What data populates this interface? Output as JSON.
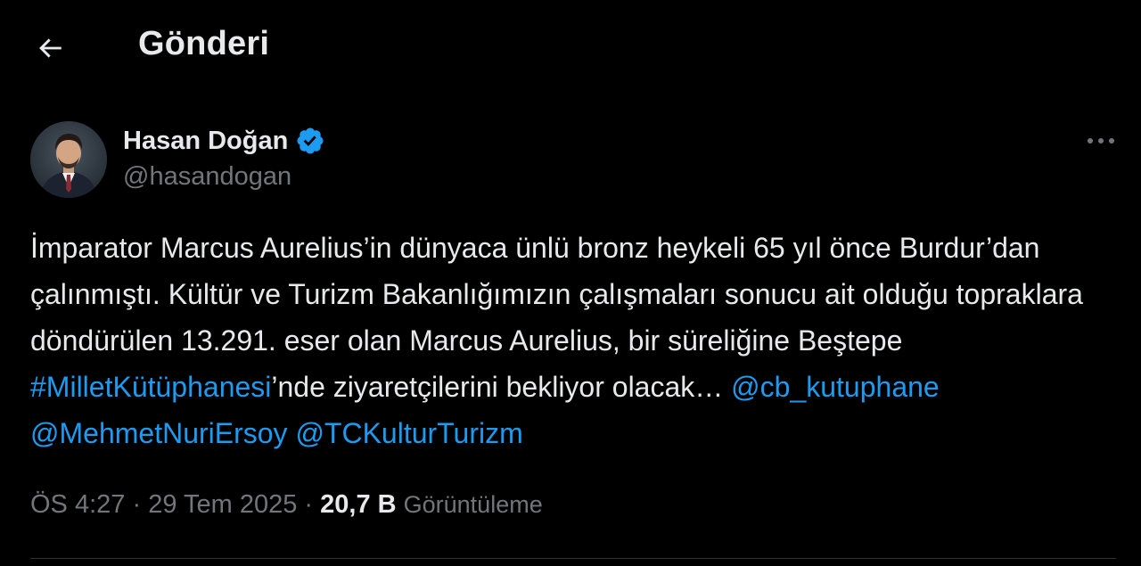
{
  "header": {
    "title": "Gönderi",
    "back_icon": "arrow-left-icon"
  },
  "author": {
    "name": "Hasan Doğan",
    "handle": "@hasandogan",
    "verified": true,
    "verified_color": "#1d9bf0"
  },
  "tweet": {
    "text_segments": [
      {
        "text": "İmparator Marcus Aurelius’in dünyaca ünlü bronz heykeli 65 yıl önce Burdur’dan çalınmıştı. Kültür ve Turizm Bakanlığımızın çalışmaları sonucu ait olduğu topraklara döndürülen 13.291. eser olan Marcus Aurelius, bir süreliğine Beştepe ",
        "link": false
      },
      {
        "text": "#MilletKütüphanesi",
        "link": true
      },
      {
        "text": "’nde ziyaretçilerini bekliyor olacak… ",
        "link": false
      },
      {
        "text": "@cb_kutuphane",
        "link": true
      },
      {
        "text": " ",
        "link": false
      },
      {
        "text": "@MehmetNuriErsoy",
        "link": true
      },
      {
        "text": " ",
        "link": false
      },
      {
        "text": "@TCKulturTurizm",
        "link": true
      }
    ]
  },
  "meta": {
    "time": "ÖS 4:27",
    "separator": " · ",
    "date": "29 Tem 2025",
    "views_count": "20,7 B",
    "views_label": "Görüntüleme"
  },
  "colors": {
    "background": "#000000",
    "text": "#e7e9ea",
    "secondary": "#71767b",
    "link": "#1d9bf0"
  },
  "icons": {
    "more": "more-horizontal-icon",
    "verified": "verified-badge-icon"
  }
}
